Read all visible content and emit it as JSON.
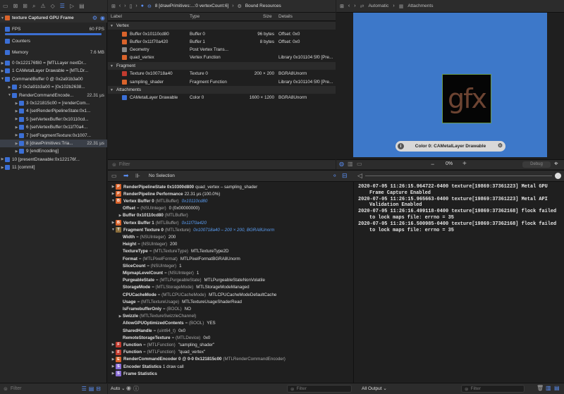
{
  "navigator": {
    "title": "texture Captured GPU Frame",
    "fps_label": "FPS",
    "fps_value": "60 FPS",
    "fps_fraction": 0.98,
    "counters_label": "Counters",
    "memory_label": "Memory",
    "memory_value": "7.6 MB",
    "tree": [
      {
        "depth": 0,
        "text": "0 0x122176f80 = [MTLLayer nextDr...",
        "color": "#3b6fd6",
        "open": false
      },
      {
        "depth": 0,
        "text": "1 CAMetalLayer Drawable = [MTLDr...",
        "color": "#3b6fd6",
        "open": false
      },
      {
        "depth": 0,
        "text": "CommandBuffer 0 @ 0x2a91b3a00",
        "color": "#3b6fd6",
        "open": true
      },
      {
        "depth": 1,
        "text": "2 0x2a91b3a00 = [0x102b2638...",
        "color": "#3b6fd6",
        "open": false
      },
      {
        "depth": 1,
        "text": "RenderCommandEncode...",
        "value": "22.31 µs",
        "color": "#3b6fd6",
        "open": true
      },
      {
        "depth": 2,
        "text": "3 0x121815c00 = [renderCom...",
        "color": "#3b6fd6",
        "open": false
      },
      {
        "depth": 2,
        "text": "4 [setRenderPipelineState:0x1...",
        "color": "#3b6fd6",
        "open": false
      },
      {
        "depth": 2,
        "text": "5 [setVertexBuffer:0x10110cd...",
        "color": "#3b6fd6",
        "open": false
      },
      {
        "depth": 2,
        "text": "6 [setVertexBuffer:0x11f70a4...",
        "color": "#3b6fd6",
        "open": false
      },
      {
        "depth": 2,
        "text": "7 [setFragmentTexture:0x1007...",
        "color": "#3b6fd6",
        "open": false
      },
      {
        "depth": 2,
        "text": "8 [drawPrimitives:Tria...",
        "value": "22.31 µs",
        "color": "#3b6fd6",
        "open": false,
        "selected": true
      },
      {
        "depth": 2,
        "text": "9 [endEncoding]",
        "color": "#3b6fd6",
        "open": false
      },
      {
        "depth": 0,
        "text": "10 [presentDrawable:0x122176f...",
        "color": "#3b6fd6",
        "open": false
      },
      {
        "depth": 0,
        "text": "11 [commit]",
        "color": "#3b6fd6",
        "open": false
      }
    ],
    "filter_placeholder": "Filter"
  },
  "jump_bar": {
    "item1": "8 [drawPrimitives:...:0 vertexCount:6]",
    "item2": "Bound Resources"
  },
  "resources": {
    "headers": {
      "label": "Label",
      "type": "Type",
      "size": "Size",
      "details": "Details"
    },
    "rows": [
      {
        "kind": "section",
        "label": "Vertex"
      },
      {
        "kind": "item",
        "icon": "buffer",
        "color": "#d9632b",
        "label": "Buffer 0x10110cd80",
        "type": "Buffer 0",
        "size": "96 bytes",
        "details": "Offset: 0x0"
      },
      {
        "kind": "item",
        "icon": "buffer",
        "color": "#d9632b",
        "label": "Buffer 0x11f70a420",
        "type": "Buffer 1",
        "size": "8 bytes",
        "details": "Offset: 0x0"
      },
      {
        "kind": "item",
        "icon": "geometry",
        "color": "#888888",
        "label": "Geometry",
        "type": "Post Vertex Trans...",
        "size": "",
        "details": ""
      },
      {
        "kind": "item",
        "icon": "function",
        "color": "#d9632b",
        "label": "quad_vertex",
        "type": "Vertex Function",
        "size": "",
        "details": "Library 0x101104 5f0 [Pre..."
      },
      {
        "kind": "section",
        "label": "Fragment"
      },
      {
        "kind": "item",
        "icon": "texture",
        "color": "#c23b2f",
        "label": "Texture 0x100718a40",
        "type": "Texture 0",
        "size": "200 × 200",
        "details": "BGRA8Unorm"
      },
      {
        "kind": "item",
        "icon": "function",
        "color": "#d9632b",
        "label": "sampling_shader",
        "type": "Fragment Function",
        "size": "",
        "details": "Library 0x101104 5f0 [Pre..."
      },
      {
        "kind": "section",
        "label": "Attachments"
      },
      {
        "kind": "item",
        "icon": "attachment",
        "color": "#3b6fd6",
        "label": "CAMetalLayer Drawable",
        "type": "Color 0",
        "size": "1600 × 1200",
        "details": "BGRA8Unorm"
      }
    ],
    "filter_placeholder": "Filter"
  },
  "viewer": {
    "crumb1": "Automatic",
    "crumb2": "Attachments",
    "texture_text": "gfx",
    "pill_label": "Color 0: CAMetalLayer Drawable",
    "zoom": "0%",
    "button": "Debug"
  },
  "debug_bar": {
    "selection": "No Selection"
  },
  "variables": [
    {
      "d": 0,
      "tri": "▶",
      "color": "#d9632b",
      "letter": "P",
      "name": "RenderPipelineState 0x10300d800",
      "rest": "quad_vertex – sampling_shader"
    },
    {
      "d": 0,
      "tri": "▶",
      "color": "#d9632b",
      "letter": "P",
      "name": "RenderPipeline Performance",
      "rest": "22.31 µs (100.0%)"
    },
    {
      "d": 0,
      "tri": "▼",
      "color": "#d9632b",
      "letter": "B",
      "name": "Vertex Buffer 0",
      "type": "(MTLBuffer)",
      "blue": "0x10110cd80"
    },
    {
      "d": 1,
      "tri": "",
      "name": "Offset",
      "type": "= (NSUInteger)",
      "rest": "0 (0x00000000)"
    },
    {
      "d": 1,
      "tri": "▶",
      "name": "Buffer 0x10110cd80",
      "type": "(MTLBuffer)"
    },
    {
      "d": 0,
      "tri": "▶",
      "color": "#d9632b",
      "letter": "B",
      "name": "Vertex Buffer 1",
      "type": "(MTLBuffer)",
      "blue": "0x11f70a420"
    },
    {
      "d": 0,
      "tri": "▼",
      "color": "#8a6d3b",
      "letter": "T",
      "name": "Fragment Texture 0",
      "type": "(MTLTexture)",
      "blue": "0x100718a40 – 200 × 200, BGRA8Unorm"
    },
    {
      "d": 1,
      "tri": "",
      "name": "Width",
      "type": "= (NSUInteger)",
      "rest": "200"
    },
    {
      "d": 1,
      "tri": "",
      "name": "Height",
      "type": "= (NSUInteger)",
      "rest": "200"
    },
    {
      "d": 1,
      "tri": "",
      "name": "TextureType",
      "type": "= (MTLTextureType)",
      "rest": "MTLTextureType2D"
    },
    {
      "d": 1,
      "tri": "",
      "name": "Format",
      "type": "= (MTLPixelFormat)",
      "rest": "MTLPixelFormatBGRA8Unorm"
    },
    {
      "d": 1,
      "tri": "",
      "name": "SliceCount",
      "type": "= (NSUInteger)",
      "rest": "1"
    },
    {
      "d": 1,
      "tri": "",
      "name": "MipmapLevelCount",
      "type": "= (NSUInteger)",
      "rest": "1"
    },
    {
      "d": 1,
      "tri": "",
      "name": "PurgeableState",
      "type": "= (MTLPurgeableState)",
      "rest": "MTLPurgeableStateNonVolatile"
    },
    {
      "d": 1,
      "tri": "",
      "name": "StorageMode",
      "type": "= (MTLStorageMode)",
      "rest": "MTLStorageModeManaged"
    },
    {
      "d": 1,
      "tri": "",
      "name": "CPUCacheMode",
      "type": "= (MTLCPUCacheMode)",
      "rest": "MTLCPUCacheModeDefaultCache"
    },
    {
      "d": 1,
      "tri": "",
      "name": "Usage",
      "type": "= (MTLTextureUsage)",
      "rest": "MTLTextureUsageShaderRead"
    },
    {
      "d": 1,
      "tri": "",
      "name": "IsFramebufferOnly",
      "type": "= (BOOL)",
      "rest": "NO"
    },
    {
      "d": 1,
      "tri": "▶",
      "name": "Swizzle",
      "type": "(MTLTextureSwizzleChannel)"
    },
    {
      "d": 1,
      "tri": "",
      "name": "AllowGPUOptimizedContents",
      "type": "= (BOOL)",
      "rest": "YES"
    },
    {
      "d": 1,
      "tri": "",
      "name": "SharedHandle",
      "type": "= (uint64_t)",
      "rest": "0x0"
    },
    {
      "d": 1,
      "tri": "",
      "name": "RemoteStorageTexture",
      "type": "= (MTLDevice)",
      "rest": "0x0"
    },
    {
      "d": 0,
      "tri": "▶",
      "color": "#c23b2f",
      "letter": "F",
      "name": "Function",
      "type": "= (MTLFunction)",
      "rest": "\"sampling_shader\""
    },
    {
      "d": 0,
      "tri": "▶",
      "color": "#c23b2f",
      "letter": "F",
      "name": "Function",
      "type": "= (MTLFunction)",
      "rest": "\"quad_vertex\""
    },
    {
      "d": 0,
      "tri": "▶",
      "color": "#d9632b",
      "letter": "E",
      "name": "RenderCommandEncoder 0 @ 0-0 0x121815c00",
      "type": "(MTLRenderCommandEncoder)"
    },
    {
      "d": 0,
      "tri": "▶",
      "color": "#8a6dd6",
      "letter": "S",
      "name": "Encoder Statistics",
      "rest": "1 draw call"
    },
    {
      "d": 0,
      "tri": "▶",
      "color": "#8a6dd6",
      "letter": "S",
      "name": "Frame Statistics",
      "rest": ""
    }
  ],
  "console": {
    "lines": [
      "2020-07-05 11:26:15.964722-0400 texture[19869:37361223] Metal GPU Frame Capture Enabled",
      "2020-07-05 11:26:15.965663-0400 texture[19869:37361223] Metal API Validation Enabled",
      "2020-07-05 11:26:16.499118-0400 texture[19869:37362168] flock failed to lock maps file: errno = 35",
      "2020-07-05 11:26:16.500985-0400 texture[19869:37362168] flock failed to lock maps file: errno = 35"
    ]
  },
  "bottom": {
    "auto": "Auto",
    "filter1": "Filter",
    "output": "All Output",
    "filter2": "Filter"
  }
}
